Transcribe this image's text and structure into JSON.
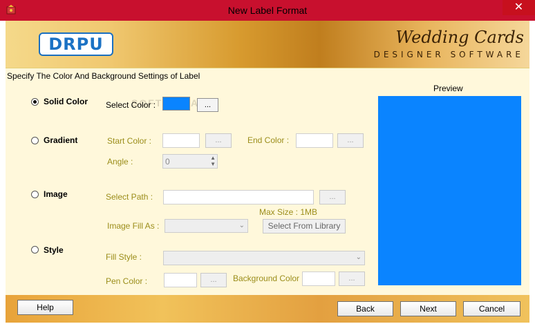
{
  "window": {
    "title": "New Label Format",
    "close_glyph": "✕"
  },
  "banner": {
    "logo_text": "DRPU",
    "brand_line1": "Wedding Cards",
    "brand_line2": "DESIGNER SOFTWARE"
  },
  "heading": "Specify The Color And Background Settings of Label",
  "watermark": "SOFTPEDIA",
  "options": {
    "solid": {
      "label": "Solid Color",
      "selected": true,
      "select_color_label": "Select Color :",
      "color_value": "#0a84ff",
      "browse": "..."
    },
    "gradient": {
      "label": "Gradient",
      "selected": false,
      "start_label": "Start Color :",
      "end_label": "End Color :",
      "start_browse": "...",
      "end_browse": "...",
      "angle_label": "Angle :",
      "angle_value": "0"
    },
    "image": {
      "label": "Image",
      "selected": false,
      "path_label": "Select Path :",
      "path_browse": "...",
      "max_size": "Max Size : 1MB",
      "fill_label": "Image Fill As :",
      "library_button": "Select From Library"
    },
    "style": {
      "label": "Style",
      "selected": false,
      "fill_label": "Fill Style :",
      "pen_label": "Pen Color :",
      "pen_browse": "...",
      "bg_label": "Background Color :",
      "bg_browse": "..."
    }
  },
  "preview": {
    "label": "Preview",
    "color": "#0a84ff"
  },
  "footer": {
    "help": "Help",
    "back": "Back",
    "next": "Next",
    "cancel": "Cancel"
  }
}
